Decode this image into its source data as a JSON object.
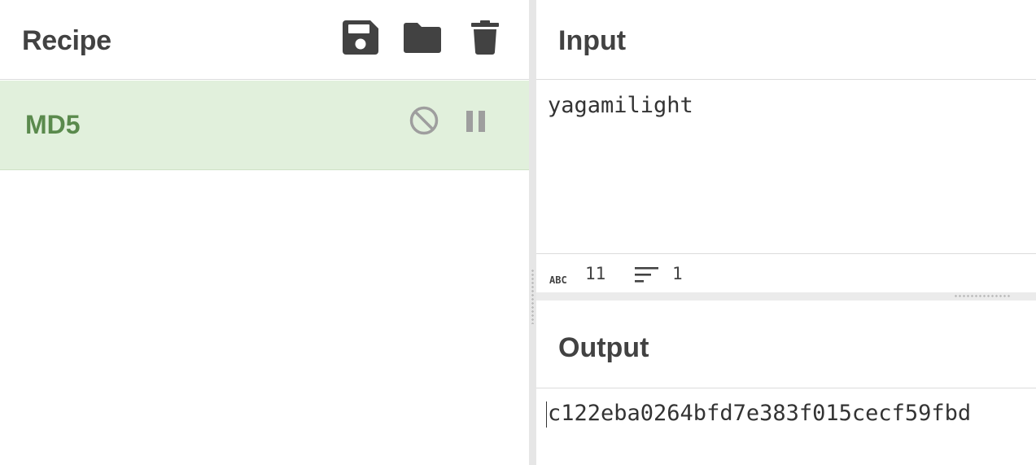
{
  "recipe": {
    "title": "Recipe",
    "header_icons": [
      "save-icon",
      "folder-icon",
      "trash-icon"
    ],
    "operations": [
      {
        "name": "MD5",
        "icons": [
          "disable-icon",
          "pause-icon"
        ]
      }
    ],
    "colors": {
      "operation_bg": "#e1f0dc",
      "operation_text": "#5a8a4d"
    }
  },
  "input": {
    "title": "Input",
    "text": "yagamilight",
    "status": {
      "length_icon": "abc-icon",
      "length": "11",
      "lines_icon": "lines-icon",
      "lines": "1"
    }
  },
  "output": {
    "title": "Output",
    "text": "c122eba0264bfd7e383f015cecf59fbd"
  }
}
